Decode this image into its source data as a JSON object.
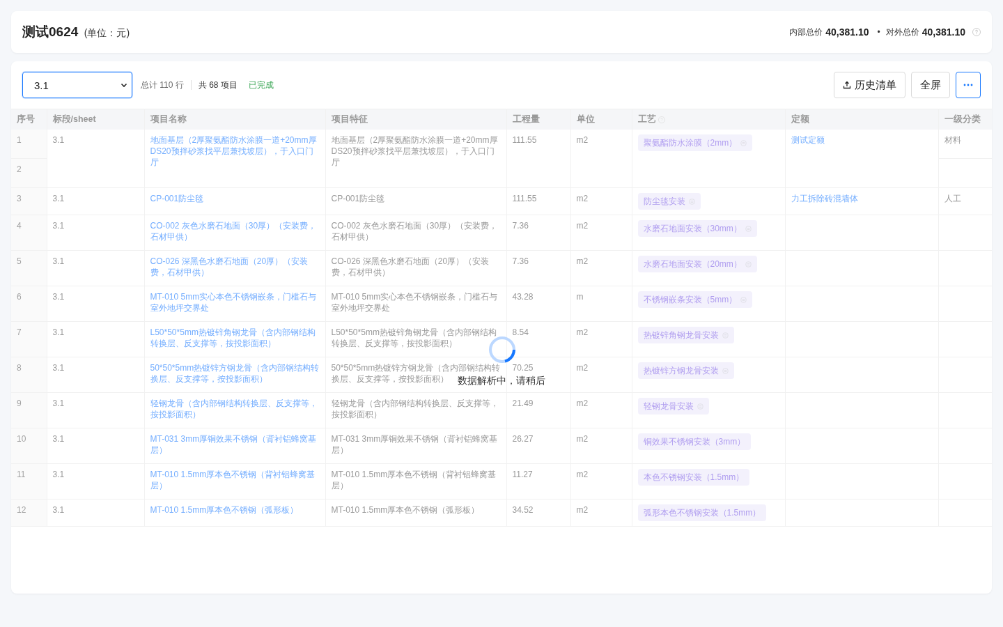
{
  "header": {
    "title": "测试0624",
    "unit": "(单位：元)",
    "internal_label": "内部总价",
    "internal_total": "40,381.10",
    "separator": "•",
    "external_label": "对外总价",
    "external_total": "40,381.10"
  },
  "toolbar": {
    "sheet_value": "3.1",
    "total_rows": "总计 110 行",
    "total_items": "共 68 项目",
    "status": "已完成",
    "buttons": [
      {
        "kind": "history",
        "label": "历史清单"
      },
      {
        "kind": "fullscreen",
        "label": "全屏"
      },
      {
        "kind": "more"
      }
    ]
  },
  "table": {
    "columns": [
      {
        "label": "序号"
      },
      {
        "label": "标段/sheet"
      },
      {
        "label": "项目名称"
      },
      {
        "label": "项目特征"
      },
      {
        "label": "工程量"
      },
      {
        "label": "单位"
      },
      {
        "label": "工艺",
        "help": true
      },
      {
        "label": "定额"
      },
      {
        "label": "一级分类"
      }
    ],
    "rows": [
      {
        "numbers": [
          "1",
          "2"
        ],
        "sheet": "3.1",
        "name": "地面基层（2厚聚氨酯防水涂膜一道+20mm厚DS20预拌砂浆找平层兼找坡层），于入口门厅",
        "feature": "地面基层（2厚聚氨酯防水涂膜一道+20mm厚DS20预拌砂浆找平层兼找坡层），于入口门厅",
        "quantity": "111.55",
        "unit": "m2",
        "craft": "聚氨酯防水涂膜（2mm）",
        "linked": true,
        "quota": "测试定额",
        "category": "材料"
      },
      {
        "numbers": [
          "3"
        ],
        "sheet": "3.1",
        "name": "CP-001防尘毯",
        "feature": "CP-001防尘毯",
        "quantity": "111.55",
        "unit": "m2",
        "craft": "防尘毯安装",
        "linked": true,
        "quota": "力工拆除砖混墙体",
        "category": "人工"
      },
      {
        "numbers": [
          "4"
        ],
        "sheet": "3.1",
        "name": "CO-002 灰色水磨石地面（30厚）（安装费，石材甲供）",
        "feature": "CO-002 灰色水磨石地面（30厚）（安装费，石材甲供）",
        "quantity": "7.36",
        "unit": "m2",
        "craft": "水磨石地面安装（30mm）",
        "linked": true
      },
      {
        "numbers": [
          "5"
        ],
        "sheet": "3.1",
        "name": "CO-026 深黑色水磨石地面（20厚）（安装费，石材甲供）",
        "feature": "CO-026 深黑色水磨石地面（20厚）（安装费，石材甲供）",
        "quantity": "7.36",
        "unit": "m2",
        "craft": "水磨石地面安装（20mm）",
        "linked": true
      },
      {
        "numbers": [
          "6"
        ],
        "sheet": "3.1",
        "name": "MT-010 5mm实心本色不锈钢嵌条，门槛石与室外地坪交界处",
        "feature": "MT-010 5mm实心本色不锈钢嵌条，门槛石与室外地坪交界处",
        "quantity": "43.28",
        "unit": "m",
        "craft": "不锈钢嵌条安装（5mm）",
        "linked": true
      },
      {
        "numbers": [
          "7"
        ],
        "sheet": "3.1",
        "name": "L50*50*5mm热镀锌角钢龙骨（含内部钢结构转换层、反支撑等，按投影面积）",
        "feature": "L50*50*5mm热镀锌角钢龙骨（含内部钢结构转换层、反支撑等，按投影面积）",
        "quantity": "8.54",
        "unit": "m2",
        "craft": "热镀锌角钢龙骨安装",
        "linked": true
      },
      {
        "numbers": [
          "8"
        ],
        "sheet": "3.1",
        "name": "50*50*5mm热镀锌方钢龙骨（含内部钢结构转换层、反支撑等，按投影面积）",
        "feature": "50*50*5mm热镀锌方钢龙骨（含内部钢结构转换层、反支撑等，按投影面积）",
        "quantity": "70.25",
        "unit": "m2",
        "craft": "热镀锌方钢龙骨安装",
        "linked": true
      },
      {
        "numbers": [
          "9"
        ],
        "sheet": "3.1",
        "name": "轻钢龙骨（含内部钢结构转换层、反支撑等，按投影面积）",
        "feature": "轻钢龙骨（含内部钢结构转换层、反支撑等，按投影面积）",
        "quantity": "21.49",
        "unit": "m2",
        "craft": "轻钢龙骨安装",
        "linked": true
      },
      {
        "numbers": [
          "10"
        ],
        "sheet": "3.1",
        "name": "MT-031 3mm厚铜效果不锈钢（背衬铝蜂窝基层）",
        "feature": "MT-031 3mm厚铜效果不锈钢（背衬铝蜂窝基层）",
        "quantity": "26.27",
        "unit": "m2",
        "craft": "铜效果不锈钢安装（3mm）",
        "linked": false
      },
      {
        "numbers": [
          "11"
        ],
        "sheet": "3.1",
        "name": "MT-010 1.5mm厚本色不锈钢（背衬铝蜂窝基层）",
        "feature": "MT-010 1.5mm厚本色不锈钢（背衬铝蜂窝基层）",
        "quantity": "11.27",
        "unit": "m2",
        "craft": "本色不锈钢安装（1.5mm）",
        "linked": false
      },
      {
        "numbers": [
          "12"
        ],
        "sheet": "3.1",
        "name": "MT-010 1.5mm厚本色不锈钢（弧形板）",
        "feature": "MT-010 1.5mm厚本色不锈钢（弧形板）",
        "quantity": "34.52",
        "unit": "m2",
        "craft": "弧形本色不锈钢安装（1.5mm）",
        "linked": false
      }
    ]
  },
  "loading": {
    "active": true,
    "text": "数据解析中，请稍后"
  }
}
